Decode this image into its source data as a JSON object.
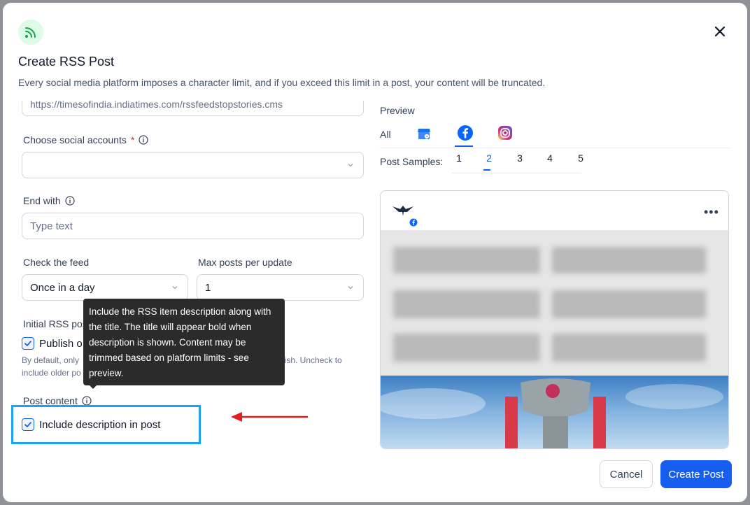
{
  "modal": {
    "title": "Create RSS Post",
    "subtitle": "Every social media platform imposes a character limit, and if you exceed this limit in a post, your content will be truncated.",
    "header_icon": "rss-icon",
    "close_icon": "close-icon"
  },
  "form": {
    "feed_url": {
      "value": "https://timesofindia.indiatimes.com/rssfeedstopstories.cms"
    },
    "social_accounts": {
      "label": "Choose social accounts",
      "required_mark": "*",
      "value": ""
    },
    "end_with": {
      "label": "End with",
      "placeholder": "Type text"
    },
    "check_feed": {
      "label": "Check the feed",
      "value": "Once in a day"
    },
    "max_posts": {
      "label": "Max posts per update",
      "value": "1"
    },
    "initial_rss": {
      "label": "Initial RSS pos",
      "checkbox_label": "Publish o",
      "checked": true,
      "helper_line1_a": "By default, only",
      "helper_line1_b": "lish. Uncheck to",
      "helper_line2": "include older po"
    },
    "post_content": {
      "label": "Post content",
      "checkbox_label": "Include description in post",
      "checked": true
    }
  },
  "tooltip": {
    "text": "Include the RSS item description along with the title. The title will appear bold when description is shown. Content may be trimmed based on platform limits - see preview."
  },
  "annotation": {
    "highlight_color": "#1da1f2",
    "arrow_color": "#e11d1d"
  },
  "preview": {
    "label": "Preview",
    "tabs": {
      "all": "All",
      "gmb_icon": "google-business-icon",
      "facebook_icon": "facebook-icon",
      "instagram_icon": "instagram-icon",
      "active": "facebook"
    },
    "samples_label": "Post Samples:",
    "samples": [
      "1",
      "2",
      "3",
      "4",
      "5"
    ],
    "active_sample": "2",
    "more_icon": "more-horizontal-icon"
  },
  "footer": {
    "cancel": "Cancel",
    "create": "Create Post"
  },
  "colors": {
    "primary": "#155eef",
    "rss_green": "#16a34a",
    "tooltip_bg": "#2b2b2b"
  }
}
